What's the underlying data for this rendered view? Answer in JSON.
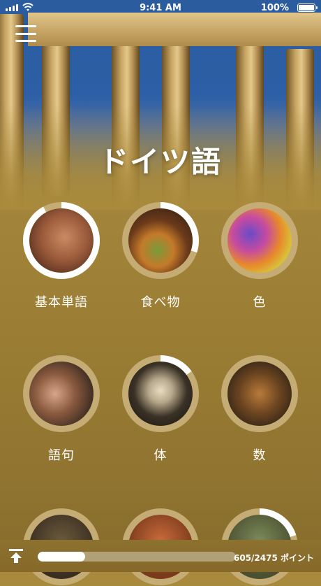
{
  "status_bar": {
    "time": "9:41 AM",
    "battery_pct": "100%",
    "icons": [
      "signal-icon",
      "wifi-icon",
      "battery-icon"
    ]
  },
  "header": {
    "menu_icon": "hamburger-menu-icon",
    "title": "ドイツ語"
  },
  "categories": [
    {
      "label": "基本単語",
      "progress": 0.92,
      "image": "baby-face"
    },
    {
      "label": "食べ物",
      "progress": 0.3,
      "image": "burger-food"
    },
    {
      "label": "色",
      "progress": 0.0,
      "image": "colored-powder"
    },
    {
      "label": "語句",
      "progress": 0.0,
      "image": "smiling-people"
    },
    {
      "label": "体",
      "progress": 0.15,
      "image": "skeleton"
    },
    {
      "label": "数",
      "progress": 0.0,
      "image": "wooden-numbers"
    }
  ],
  "footer": {
    "upload_icon": "arrow-up-to-line-icon",
    "progress": 0.24,
    "points_text": "605/2475 ポイント"
  },
  "colors": {
    "background": "#a48a3c",
    "ring_track": "#c4ac74",
    "ring_fill": "#ffffff"
  }
}
